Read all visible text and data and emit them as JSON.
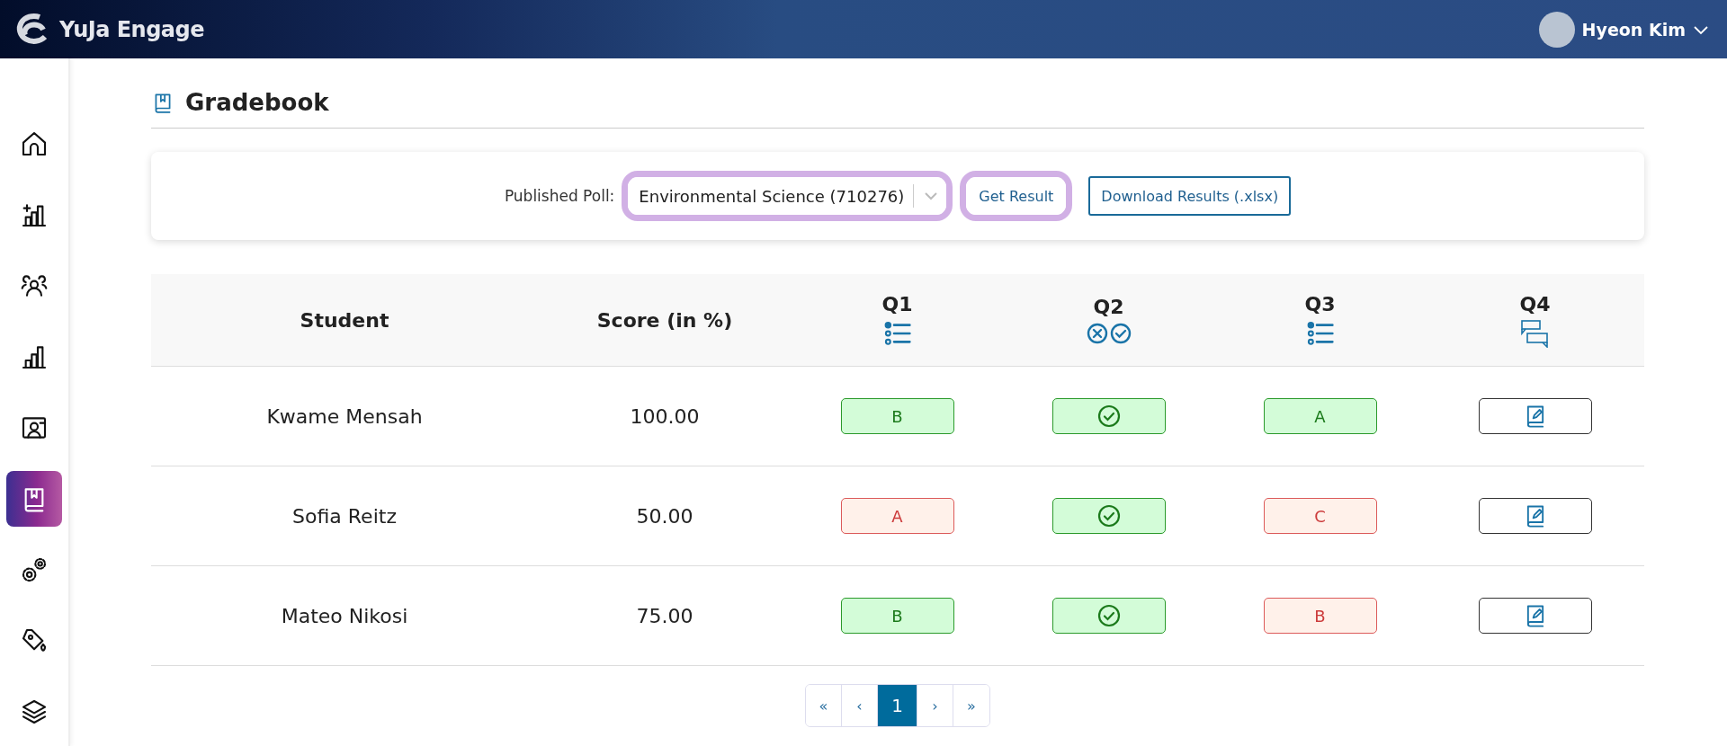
{
  "header": {
    "brand": "YuJa Engage",
    "user": "Hyeon Kim"
  },
  "sidebar": {
    "items": [
      {
        "kind": "home",
        "selected": false
      },
      {
        "kind": "create",
        "selected": false
      },
      {
        "kind": "people",
        "selected": false
      },
      {
        "kind": "reports",
        "selected": false
      },
      {
        "kind": "present",
        "selected": false
      },
      {
        "kind": "gradebook",
        "selected": true
      },
      {
        "kind": "settings",
        "selected": false
      },
      {
        "kind": "branding",
        "selected": false
      },
      {
        "kind": "layers",
        "selected": false
      }
    ]
  },
  "page": {
    "title": "Gradebook"
  },
  "filter": {
    "label": "Published Poll:",
    "poll": "Environmental Science (710276)",
    "get_button": "Get Result",
    "download_button": "Download Results (.xlsx)"
  },
  "table": {
    "columns": [
      {
        "label": "Student"
      },
      {
        "label": "Score (in %)"
      },
      {
        "label": "Q1",
        "kind": "choice"
      },
      {
        "label": "Q2",
        "kind": "truefalse"
      },
      {
        "label": "Q3",
        "kind": "choice"
      },
      {
        "label": "Q4",
        "kind": "qa"
      }
    ],
    "rows": [
      {
        "student": "Kwame Mensah",
        "score": "100.00",
        "answers": [
          {
            "kind": "choice",
            "text": "B",
            "correct": true
          },
          {
            "kind": "truefalse",
            "correct": true
          },
          {
            "kind": "choice",
            "text": "A",
            "correct": true
          },
          {
            "kind": "essay"
          }
        ]
      },
      {
        "student": "Sofia Reitz",
        "score": "50.00",
        "answers": [
          {
            "kind": "choice",
            "text": "A",
            "correct": false
          },
          {
            "kind": "truefalse",
            "correct": true
          },
          {
            "kind": "choice",
            "text": "C",
            "correct": false
          },
          {
            "kind": "essay"
          }
        ]
      },
      {
        "student": "Mateo Nikosi",
        "score": "75.00",
        "answers": [
          {
            "kind": "choice",
            "text": "B",
            "correct": true
          },
          {
            "kind": "truefalse",
            "correct": true
          },
          {
            "kind": "choice",
            "text": "B",
            "correct": false
          },
          {
            "kind": "essay"
          }
        ]
      }
    ]
  },
  "pagination": [
    {
      "label": "«",
      "selected": false
    },
    {
      "label": "‹",
      "selected": false
    },
    {
      "label": "1",
      "selected": true
    },
    {
      "label": "›",
      "selected": false
    },
    {
      "label": "»",
      "selected": false
    }
  ]
}
